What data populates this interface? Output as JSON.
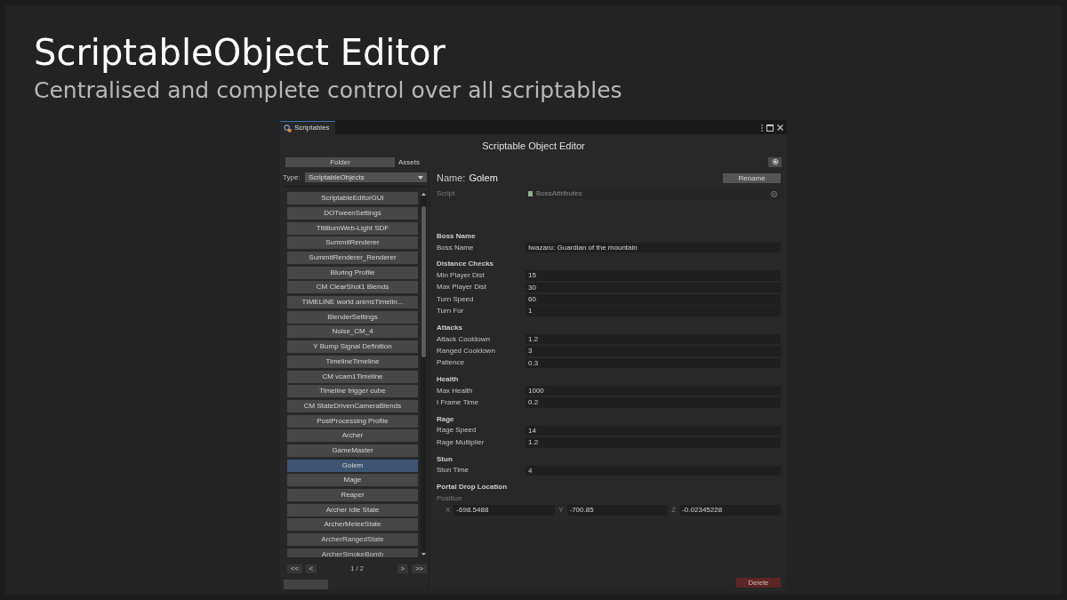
{
  "slide": {
    "title": "ScriptableObject Editor",
    "subtitle": "Centralised and complete control over all scriptables"
  },
  "window": {
    "tab": "Scriptables",
    "title": "Scriptable Object Editor"
  },
  "mode_tabs": [
    {
      "label": "Folder",
      "selected": true
    },
    {
      "label": "Assets",
      "selected": false
    }
  ],
  "type_filter": {
    "label": "Type:",
    "value": "ScriptableObjects"
  },
  "items": [
    {
      "label": "ScriptableEditorGUI",
      "selected": false
    },
    {
      "label": "DOTweenSettings",
      "selected": false
    },
    {
      "label": "TitilliumWeb-Light SDF",
      "selected": false
    },
    {
      "label": "SummitRenderer",
      "selected": false
    },
    {
      "label": "SummitRenderer_Renderer",
      "selected": false
    },
    {
      "label": "Bluring Profile",
      "selected": false
    },
    {
      "label": "CM ClearShot1 Blends",
      "selected": false
    },
    {
      "label": "TIMELINE world animsTimelin...",
      "selected": false
    },
    {
      "label": "BlenderSettings",
      "selected": false
    },
    {
      "label": "Noise_CM_4",
      "selected": false
    },
    {
      "label": "Y Bump Signal Definition",
      "selected": false
    },
    {
      "label": "TimelineTimeline",
      "selected": false
    },
    {
      "label": "CM vcam1Timeline",
      "selected": false
    },
    {
      "label": "Timeline trigger cube",
      "selected": false
    },
    {
      "label": "CM StateDrivenCameraBlends",
      "selected": false
    },
    {
      "label": "PostProcessing Profile",
      "selected": false
    },
    {
      "label": "Archer",
      "selected": false
    },
    {
      "label": "GameMaster",
      "selected": false
    },
    {
      "label": "Golem",
      "selected": true
    },
    {
      "label": "Mage",
      "selected": false
    },
    {
      "label": "Reaper",
      "selected": false
    },
    {
      "label": "Archer Idle State",
      "selected": false
    },
    {
      "label": "ArcherMeleeState",
      "selected": false
    },
    {
      "label": "ArcherRangedState",
      "selected": false
    },
    {
      "label": "ArcherSmokeBomb",
      "selected": false
    }
  ],
  "pagination": {
    "first": "<<",
    "prev": "<",
    "page": "1 / 2",
    "next": ">",
    "last": ">>"
  },
  "inspector": {
    "name_label": "Name:",
    "name": "Golem",
    "rename": "Rename",
    "script_label": "Script",
    "script": "BossAttributes",
    "sections": [
      {
        "header": "Boss Name",
        "fields": [
          {
            "kind": "text",
            "label": "Boss Name",
            "value": "Iwazaru: Guardian of the mountain"
          }
        ]
      },
      {
        "header": "Distance Checks",
        "fields": [
          {
            "kind": "text",
            "label": "Min Player Dist",
            "value": "15"
          },
          {
            "kind": "text",
            "label": "Max Player Dist",
            "value": "30"
          },
          {
            "kind": "text",
            "label": "Turn Speed",
            "value": "60"
          },
          {
            "kind": "text",
            "label": "Turn For",
            "value": "1"
          }
        ]
      },
      {
        "header": "Attacks",
        "fields": [
          {
            "kind": "text",
            "label": "Attack Cooldown",
            "value": "1.2"
          },
          {
            "kind": "text",
            "label": "Ranged Cooldown",
            "value": "3"
          },
          {
            "kind": "text",
            "label": "Patience",
            "value": "0.3"
          }
        ]
      },
      {
        "header": "Health",
        "fields": [
          {
            "kind": "text",
            "label": "Max Health",
            "value": "1000"
          },
          {
            "kind": "text",
            "label": "I Frame Time",
            "value": "0.2"
          }
        ]
      },
      {
        "header": "Rage",
        "fields": [
          {
            "kind": "text",
            "label": "Rage Speed",
            "value": "14"
          },
          {
            "kind": "text",
            "label": "Rage Multiplier",
            "value": "1.2"
          }
        ]
      },
      {
        "header": "Stun",
        "fields": [
          {
            "kind": "text",
            "label": "Stun Time",
            "value": "4"
          }
        ]
      },
      {
        "header": "Portal Drop Location",
        "fields": [
          {
            "kind": "vector",
            "label": "Position",
            "components": [
              {
                "axis": "X",
                "value": "-698.5488"
              },
              {
                "axis": "Y",
                "value": "-700.85"
              },
              {
                "axis": "Z",
                "value": "-0.02345228"
              }
            ]
          }
        ]
      }
    ]
  },
  "footer": {
    "delete": "Delete"
  }
}
